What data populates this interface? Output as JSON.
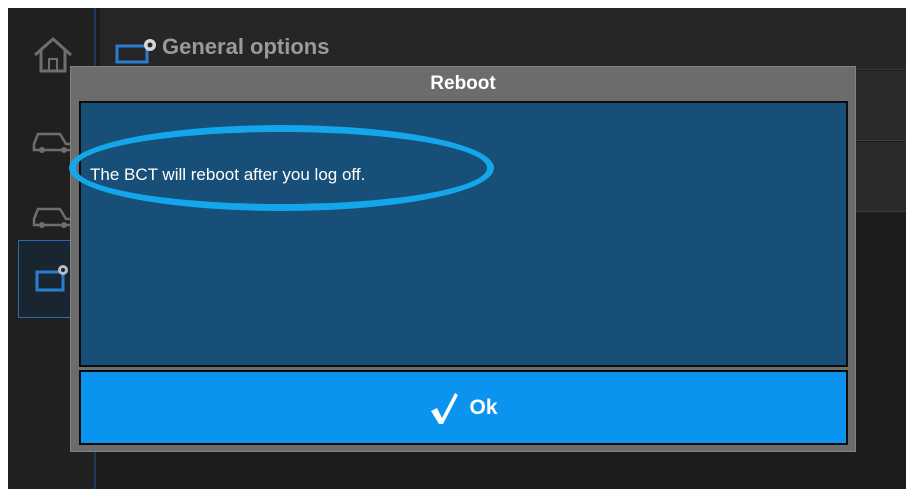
{
  "header": {
    "title": "General options",
    "icon": "settings-monitor-icon"
  },
  "sidebar": {
    "items": [
      {
        "icon": "home-icon",
        "active": false
      },
      {
        "icon": "car-settings-icon",
        "active": false
      },
      {
        "icon": "car-settings-icon",
        "active": false
      },
      {
        "icon": "settings-monitor-icon",
        "active": true
      }
    ]
  },
  "dialog": {
    "title": "Reboot",
    "message": "The BCT will reboot after you log off.",
    "ok_label": "Ok",
    "ok_icon": "checkmark-icon"
  },
  "colors": {
    "dialog_body": "#174f78",
    "ok_button": "#0a93ef",
    "highlight": "#13a6ea",
    "dialog_frame": "#6c6c6c"
  }
}
